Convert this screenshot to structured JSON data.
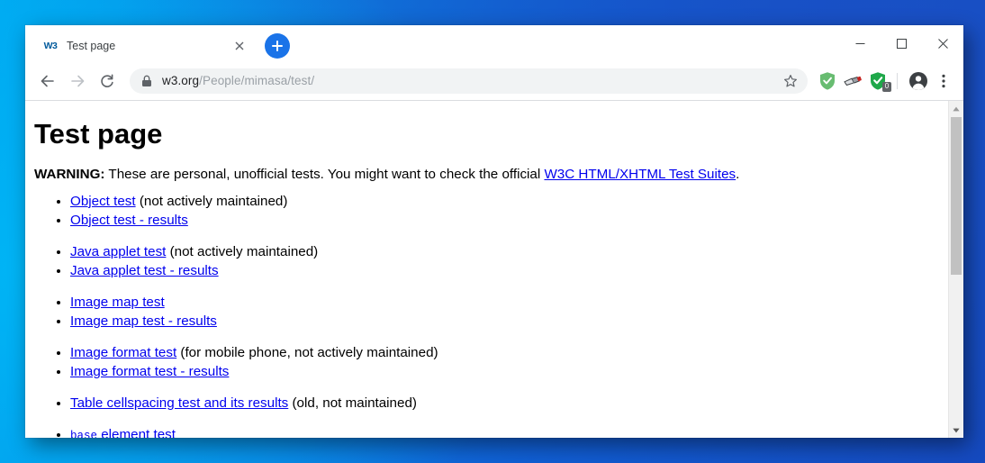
{
  "window": {
    "controls": {
      "minimize": "minimize-button",
      "maximize": "maximize-button",
      "close": "close-button"
    }
  },
  "tabstrip": {
    "tab": {
      "favicon_text": "W3",
      "title": "Test page",
      "close_label": "×"
    },
    "new_tab_label": "+"
  },
  "toolbar": {
    "back_label": "←",
    "forward_label": "→",
    "reload_label": "⟳",
    "url": {
      "host": "w3.org",
      "path": "/People/mimasa/test/",
      "full": "w3.org/People/mimasa/test/"
    },
    "security_icon": "lock-icon",
    "bookmark_icon": "star-icon",
    "extensions": [
      {
        "name": "adguard-shield-icon",
        "badge": ""
      },
      {
        "name": "extension-puzzle-icon",
        "badge": ""
      },
      {
        "name": "green-shield-check-icon",
        "badge": "0"
      }
    ],
    "profile_icon": "account-avatar-icon",
    "menu_icon": "three-dot-menu-icon"
  },
  "page": {
    "heading": "Test page",
    "warning": {
      "label": "WARNING:",
      "text_before_link": " These are personal, unofficial tests. You might want to check the official ",
      "link_text": "W3C HTML/XHTML Test Suites",
      "text_after_link": "."
    },
    "items": [
      {
        "link": "Object test",
        "suffix": " (not actively maintained)",
        "gap": false,
        "code": ""
      },
      {
        "link": "Object test - results",
        "suffix": "",
        "gap": false,
        "code": ""
      },
      {
        "link": "Java applet test",
        "suffix": " (not actively maintained)",
        "gap": true,
        "code": ""
      },
      {
        "link": "Java applet test - results",
        "suffix": "",
        "gap": false,
        "code": ""
      },
      {
        "link": "Image map test",
        "suffix": "",
        "gap": true,
        "code": ""
      },
      {
        "link": "Image map test - results",
        "suffix": "",
        "gap": false,
        "code": ""
      },
      {
        "link": "Image format test",
        "suffix": " (for mobile phone, not actively maintained)",
        "gap": true,
        "code": ""
      },
      {
        "link": "Image format test - results",
        "suffix": "",
        "gap": false,
        "code": ""
      },
      {
        "link": "Table cellspacing test and its results",
        "suffix": " (old, not maintained)",
        "gap": true,
        "code": ""
      },
      {
        "link": " element test",
        "suffix": "",
        "gap": true,
        "code": "base"
      }
    ]
  },
  "scrollbar": {
    "up_arrow": "▲",
    "down_arrow": "▼"
  },
  "colors": {
    "link": "#0000ee",
    "accent": "#1a73e8",
    "badge": "#606367"
  }
}
